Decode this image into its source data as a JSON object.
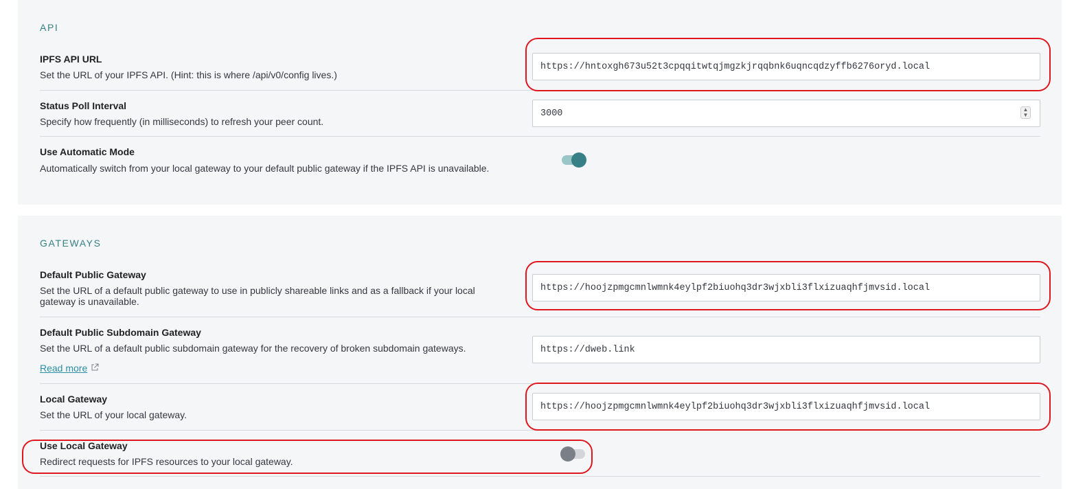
{
  "api": {
    "title": "API",
    "ipfs_api_url": {
      "label": "IPFS API URL",
      "description": "Set the URL of your IPFS API. (Hint: this is where /api/v0/config lives.)",
      "value": "https://hntoxgh673u52t3cpqqitwtqjmgzkjrqqbnk6uqncqdzyffb6276oryd.local"
    },
    "status_poll_interval": {
      "label": "Status Poll Interval",
      "description": "Specify how frequently (in milliseconds) to refresh your peer count.",
      "value": "3000"
    },
    "automatic_mode": {
      "label": "Use Automatic Mode",
      "description": "Automatically switch from your local gateway to your default public gateway if the IPFS API is unavailable.",
      "enabled": true
    }
  },
  "gateways": {
    "title": "GATEWAYS",
    "default_public_gateway": {
      "label": "Default Public Gateway",
      "description": "Set the URL of a default public gateway to use in publicly shareable links and as a fallback if your local gateway is unavailable.",
      "value": "https://hoojzpmgcmnlwmnk4eylpf2biuohq3dr3wjxbli3flxizuaqhfjmvsid.local"
    },
    "default_public_subdomain_gateway": {
      "label": "Default Public Subdomain Gateway",
      "description": "Set the URL of a default public subdomain gateway for the recovery of broken subdomain gateways.",
      "link_label": "Read more",
      "value": "https://dweb.link"
    },
    "local_gateway": {
      "label": "Local Gateway",
      "description": "Set the URL of your local gateway.",
      "value": "https://hoojzpmgcmnlwmnk4eylpf2biuohq3dr3wjxbli3flxizuaqhfjmvsid.local"
    },
    "use_local_gateway": {
      "label": "Use Local Gateway",
      "description": "Redirect requests for IPFS resources to your local gateway.",
      "enabled": false
    }
  },
  "icons": {
    "external_link": "external-link-icon",
    "spinner": "spin-arrows-icon"
  },
  "colors": {
    "accent": "#378085",
    "highlight": "#e0161f",
    "link": "#2a8ea5"
  }
}
